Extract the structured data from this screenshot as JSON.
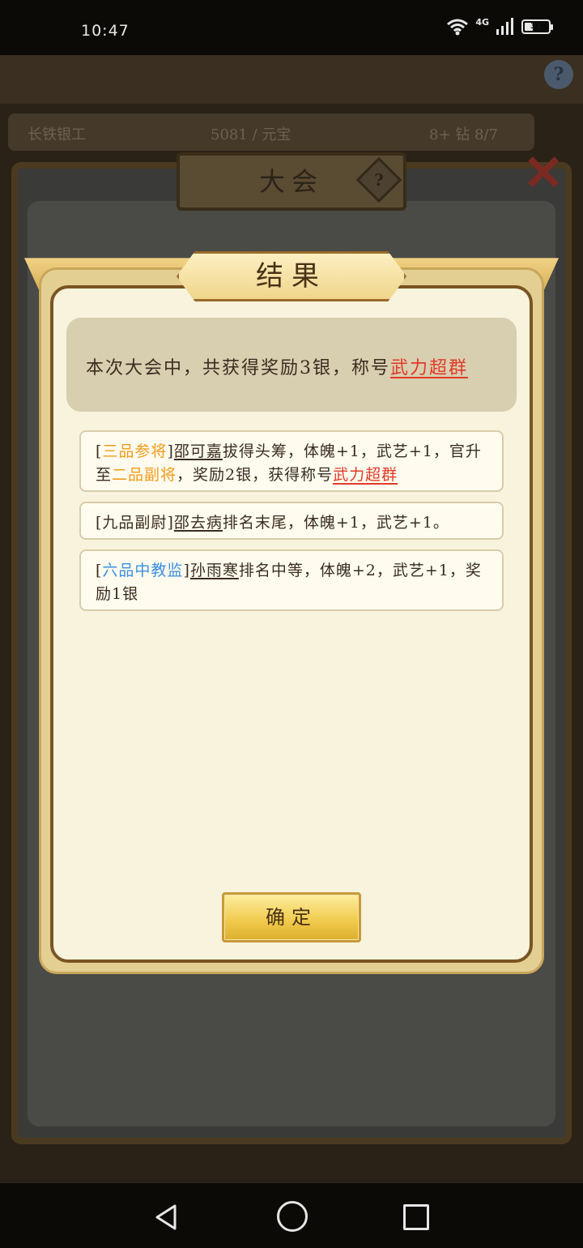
{
  "status_bar": {
    "time": "10:47",
    "network": "4G",
    "battery": "31"
  },
  "background": {
    "hud_left": "长铁银工",
    "hud_mid": "5081 / 元宝",
    "hud_right": "8+ 钻 8/7",
    "help": "?",
    "outer_title": "大会",
    "outer_help": "?"
  },
  "modal": {
    "title": "结果",
    "summary": {
      "text": "本次大会中，共获得奖励3银，称号",
      "title_award": "武力超群"
    },
    "entries": [
      {
        "open": "[",
        "rank": "三品参将",
        "close": "]",
        "name": "邵可嘉",
        "text1": "拔得头筹，体魄+1，武艺+1，官升至",
        "rank2": "二品副将",
        "text2": "，奖励2银，获得称号",
        "title_award": "武力超群"
      },
      {
        "open": "[",
        "rank": "九品副尉",
        "close": "]",
        "name": "邵去病",
        "text1": "排名末尾，体魄+1，武艺+1。"
      },
      {
        "open": "[",
        "rank": "六品中教监",
        "close": "]",
        "name": "孙雨寒",
        "text1": "排名中等，体魄+2，武艺+1，奖励1银"
      }
    ],
    "confirm_label": "确定"
  }
}
